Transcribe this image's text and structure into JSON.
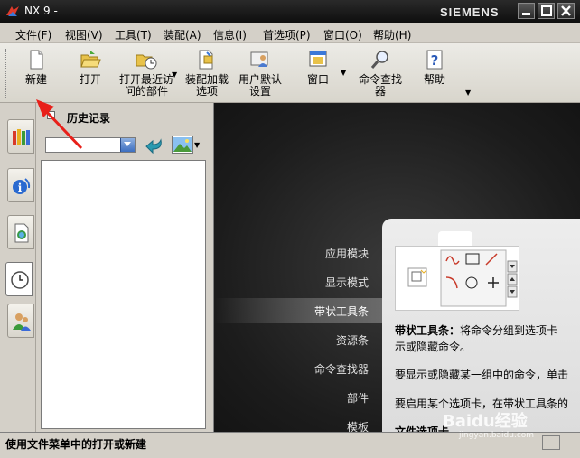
{
  "window": {
    "title": "NX 9 -",
    "brand": "SIEMENS"
  },
  "menu": [
    {
      "label": "文件(F)"
    },
    {
      "label": "视图(V)"
    },
    {
      "label": "工具(T)"
    },
    {
      "label": "装配(A)"
    },
    {
      "label": "信息(I)"
    },
    {
      "label": "首选项(P)"
    },
    {
      "label": "窗口(O)"
    },
    {
      "label": "帮助(H)"
    }
  ],
  "toolbar": {
    "new_label": "新建",
    "open_label": "打开",
    "recent_line1": "打开最近访",
    "recent_line2": "问的部件",
    "load_line1": "装配加载",
    "load_line2": "选项",
    "defaults_line1": "用户默认",
    "defaults_line2": "设置",
    "window_label": "窗口",
    "cmdfinder_line1": "命令查找",
    "cmdfinder_line2": "器",
    "help_label": "帮助"
  },
  "history": {
    "title": "历史记录"
  },
  "nav": [
    {
      "label": "应用模块"
    },
    {
      "label": "显示模式"
    },
    {
      "label": "带状工具条"
    },
    {
      "label": "资源条"
    },
    {
      "label": "命令查找器"
    },
    {
      "label": "部件"
    },
    {
      "label": "模板"
    }
  ],
  "card": {
    "heading_bold": "带状工具条：",
    "heading_rest": "将命令分组到选项卡",
    "line2": "示或隐藏命令。",
    "line3": "要显示或隐藏某一组中的命令，单击",
    "line4": "要启用某个选项卡，在带状工具条的",
    "line5": "文件选项卡"
  },
  "status": {
    "text": "使用文件菜单中的打开或新建"
  },
  "watermark": {
    "main": "Baidu经验",
    "sub": "jingyan.baidu.com"
  }
}
